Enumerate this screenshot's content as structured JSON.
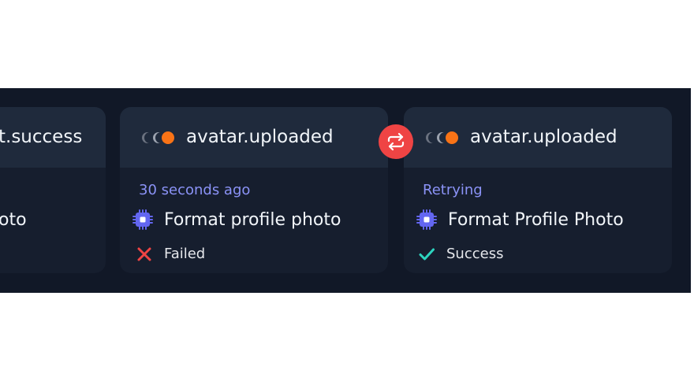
{
  "runs": [
    {
      "event": "t.success",
      "task": "oto"
    },
    {
      "event": "avatar.uploaded",
      "time_label": "30 seconds ago",
      "task": "Format profile photo",
      "status": "Failed"
    },
    {
      "event": "avatar.uploaded",
      "time_label": "Retrying",
      "task": "Format Profile Photo",
      "status": "Success"
    }
  ],
  "colors": {
    "accent_orange": "#f97316",
    "failed_red": "#ef4444",
    "success_teal": "#2dd4bf",
    "label_indigo": "#8b93f7",
    "chip_indigo": "#6366f1"
  },
  "icons": {
    "retry": "retry-arrows-icon",
    "chip": "cpu-chip-icon",
    "failed": "x-icon",
    "success": "check-icon",
    "source": "moon-dots-icon"
  }
}
